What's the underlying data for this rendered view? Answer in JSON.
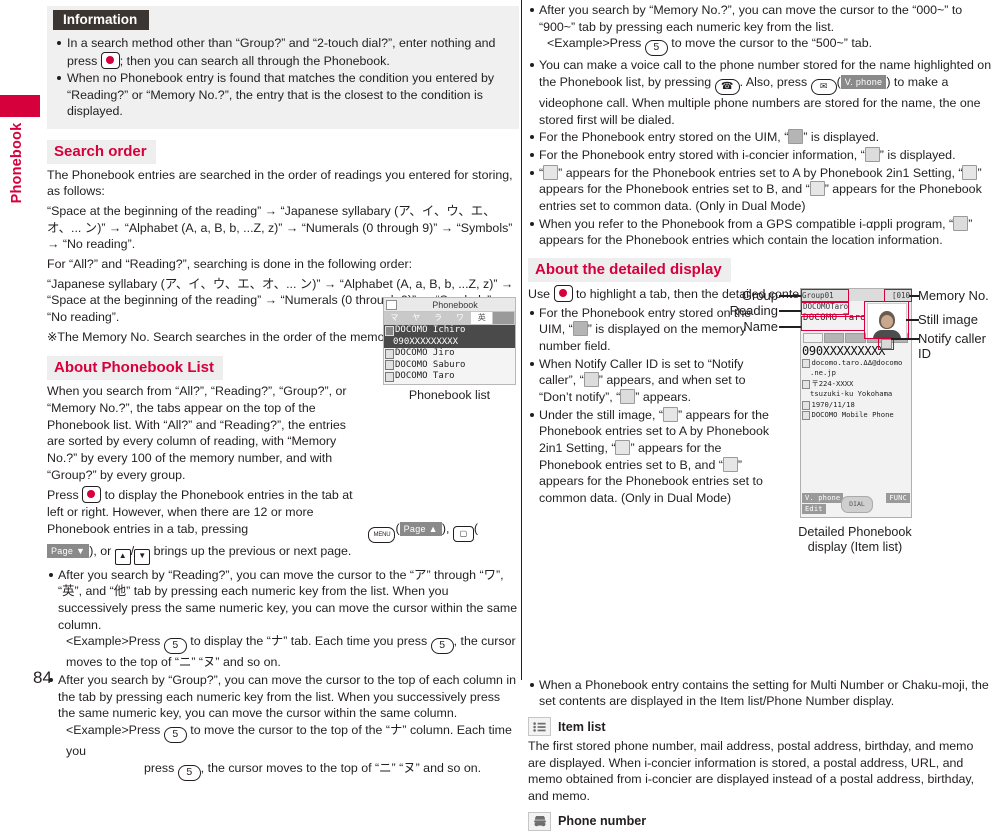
{
  "sidebar": {
    "chapter_label": "Phonebook",
    "page_number": "84"
  },
  "information": {
    "title": "Information",
    "items": [
      "In a search method other than “Group?” and “2-touch dial?”, enter nothing and press ( ); then you can search all through the Phonebook.",
      "When no Phonebook entry is found that matches the condition you entered by “Reading?” or “Memory No.?”, the entry that is the closest to the condition is displayed."
    ],
    "item1_part1": "In a search method other than “Group?” and “2-touch dial?”, enter nothing and press",
    "item1_part2": "; then you can search all through the Phonebook.",
    "item2": "When no Phonebook entry is found that matches the condition you entered by “Reading?” or “Memory No.?”, the entry that is the closest to the condition is displayed."
  },
  "search_order": {
    "heading": "Search order",
    "intro": "The Phonebook entries are searched in the order of readings you entered for storing, as follows:",
    "order1": "“Space at the beginning of the reading” → “Japanese syllabary (ア、イ、ウ、エ、オ、... ン)” → “Alphabet (A, a, B, b, ...Z, z)” → “Numerals (0 through 9)” → “Symbols” → “No reading”.",
    "mid": "For “All?” and “Reading?”, searching is done in the following order:",
    "order2": "“Japanese syllabary (ア、イ、ウ、エ、オ、... ン)” → “Alphabet (A, a, B, b, ...Z, z)” → “Space at the beginning of the reading” → “Numerals (0 through 9)” → “Symbols” → “No reading”.",
    "note": "※The Memory No. Search searches in the order of the memory numbers."
  },
  "phonebook_list_section": {
    "heading": "About Phonebook List",
    "para1": "When you search from “All?”, “Reading?”, “Group?”, or “Memory No.?”, the tabs appear on the top of the Phonebook list. With “All?” and “Reading?”, the entries are sorted by every column of reading, with “Memory No.?” by every 100 of the memory number, and with “Group?” by every group.",
    "para2_a": "Press",
    "para2_b": "to display the Phonebook entries in the tab at left or right. However, when there are 12 or more Phonebook entries in a tab, pressing",
    "page_up_label": "Page ▲",
    "page_down_label": "Page ▼",
    "para2_c": ", or",
    "para2_d": "brings up the previous or next page.",
    "bullets": [
      {
        "text_a": "After you search by “Reading?”, you can move the cursor to the “ア” through “ワ”, “英”, and “他” tab by pressing each numeric key from the list. When you successively press the same numeric key, you can move the cursor within the same column.",
        "example_a": "<Example>Press",
        "example_key": "5",
        "example_b": "to display the “ナ” tab. Each time you press",
        "example_c": ", the cursor moves to the top of “ニ” “ヌ” and so on."
      },
      {
        "text_a": "After you search by “Group?”, you can move the cursor to the top of each column in the tab by pressing each numeric key from the list. When you successively press the same numeric key, you can move the cursor within the same column.",
        "example_a": "<Example>Press",
        "example_key": "5",
        "example_b": "to move the cursor to the top of the “ナ” column. Each time you",
        "example_c": "press",
        "example_d": ", the cursor moves to the top of “ニ” “ヌ” and so on."
      }
    ]
  },
  "phonebook_list_figure": {
    "screen_title": "Phonebook",
    "tabs": [
      "マ",
      "ヤ",
      "ラ",
      "ワ",
      "英",
      ""
    ],
    "entries": [
      {
        "name": "DOCOMO Ichiro",
        "number": "090XXXXXXXXX",
        "selected": true
      },
      {
        "name": "DOCOMO Jiro",
        "selected": false
      },
      {
        "name": "DOCOMO Saburo",
        "selected": false
      },
      {
        "name": "DOCOMO Taro",
        "selected": false
      }
    ],
    "caption": "Phonebook list"
  },
  "right_bullets_top": [
    {
      "text_a": "After you search by “Memory No.?”, you can move the cursor to the “000~” to “900~” tab by pressing each numeric key from the list.",
      "example_a": "<Example>Press",
      "example_key": "5",
      "example_b": "to move the cursor to the “500~” tab."
    },
    {
      "part_a": "You can make a voice call to the phone number stored for the name highlighted on the Phonebook list, by pressing",
      "part_b": ". Also, press",
      "vphone_label": "V. phone",
      "part_c": ") to make a videophone call. When multiple phone numbers are stored for the name, the one stored first will be dialed."
    },
    {
      "part_a": "For the Phonebook entry stored on the UIM, “",
      "part_b": "” is displayed."
    },
    {
      "part_a": "For the Phonebook entry stored with i-concier information, “",
      "part_b": "” is displayed."
    },
    {
      "part_a": "“",
      "part_b": "” appears for the Phonebook entries set to A by Phonebook 2in1 Setting, “",
      "part_c": "” appears for the Phonebook entries set to B, and “",
      "part_d": "” appears for the Phonebook entries set to common data. (Only in Dual Mode)"
    },
    {
      "part_a": "When you refer to the Phonebook from a GPS compatible i-αppli program, “",
      "part_b": "” appears for the Phonebook entries which contain the location information."
    }
  ],
  "detailed_display": {
    "heading": "About the detailed display",
    "intro_a": "Use",
    "intro_b": "to highlight a tab, then the detailed contents are displayed.",
    "bullets": [
      {
        "part_a": "For the Phonebook entry stored on the UIM, “",
        "part_b": "” is displayed on the memory number field."
      },
      {
        "part_a": "When Notify Caller ID is set to “Notify caller”, “",
        "part_b": "” appears, and when set to “Don’t notify”, “",
        "part_c": "” appears."
      },
      {
        "part_a": "Under the still image, “",
        "part_b": "” appears for the Phonebook entries set to A by Phonebook 2in1 Setting, “",
        "part_c": "” appears for the Phonebook entries set to B, and “",
        "part_d": "” appears for the Phonebook entries set to common data. (Only in Dual Mode)"
      }
    ],
    "bullet_multi": "When a Phonebook entry contains the setting for Multi Number or Chaku-moji, the set contents are displayed in the Item list/Phone Number display.",
    "annotations": {
      "group": "Group",
      "reading": "Reading",
      "name": "Name",
      "memory_no": "Memory No.",
      "still_image": "Still image",
      "notify_caller_id": "Notify caller ID"
    },
    "figure": {
      "group_value": "Group01",
      "memory_no_value": "[010",
      "reading_value": "DOCOMOTaro",
      "name_value": "DOCOMO Taro",
      "phone_number": "090XXXXXXXXX",
      "mail_line1": "docomo.taro.ΔΔ@docomo",
      "mail_line2": ".ne.jp",
      "postal_line1": "〒224-XXXX",
      "postal_line2": "tsuzuki-ku Yokohama",
      "birthday": "1970/11/18",
      "memo": "DOCOMO Mobile Phone",
      "softkey_left_top": "V. phone",
      "softkey_left_bottom": "Edit",
      "softkey_right": "FUNC",
      "softkey_center": "DIAL"
    },
    "caption_line1": "Detailed Phonebook",
    "caption_line2": "display (Item list)"
  },
  "item_list": {
    "heading": "Item list",
    "body": "The first stored phone number, mail address, postal address, birthday, and memo are displayed. When i-concier information is stored, a postal address, URL, and memo obtained from i-concier are displayed instead of a postal address, birthday, and memo."
  },
  "phone_number_section": {
    "heading": "Phone number"
  },
  "colors": {
    "accent_red": "#d6003c",
    "info_title_bg": "#3c3633",
    "heading_bg": "#eeeeee",
    "text": "#231f20"
  },
  "icons": {
    "nav_key": "nav-select-key-icon",
    "menu_key": "menu-key-icon",
    "camera_key": "camera-key-icon",
    "send_key": "send-call-key-icon",
    "mail_key": "mail-key-icon",
    "up_key": "up-arrow-key-icon",
    "down_key": "down-arrow-key-icon",
    "numeric_key_5": "numeric-key-5-icon",
    "uim_icon": "uim-card-icon",
    "iconcier_icon": "i-concier-icon",
    "book_a_icon": "phonebook-2in1-a-icon",
    "book_b_icon": "phonebook-2in1-b-icon",
    "book_common_icon": "phonebook-2in1-common-icon",
    "gps_icon": "gps-location-icon",
    "notify_on_icon": "notify-caller-on-icon",
    "notify_off_icon": "notify-caller-off-icon",
    "item_list_icon": "item-list-icon",
    "phone_number_icon": "phone-handset-icon"
  }
}
